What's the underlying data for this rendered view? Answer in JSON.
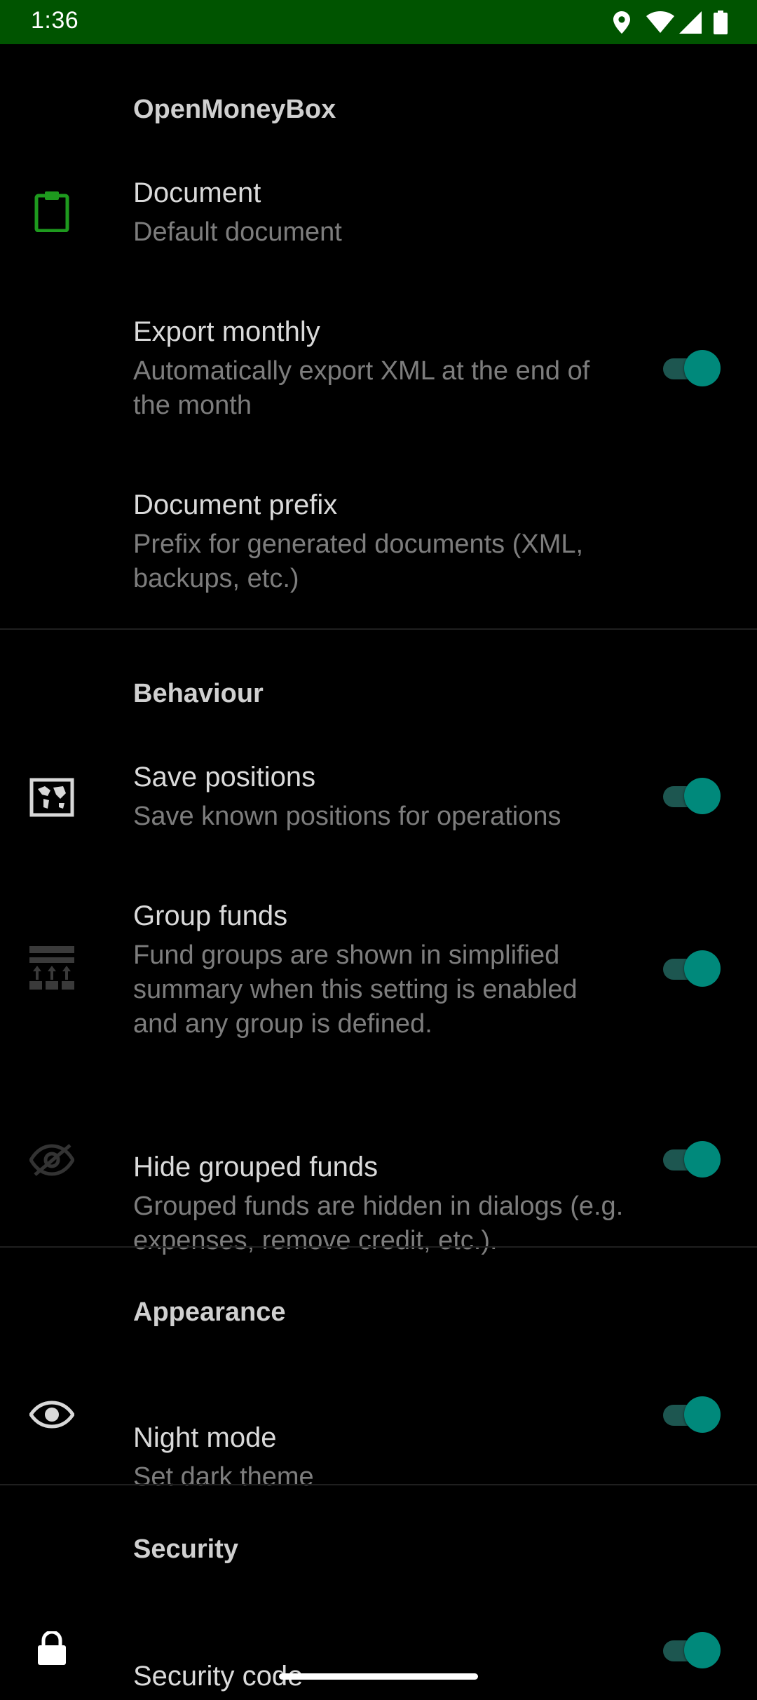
{
  "status_bar": {
    "time": "1:36",
    "icons": [
      "location-icon",
      "wifi-icon",
      "signal-icon",
      "battery-icon"
    ],
    "background": "#005400"
  },
  "colors": {
    "accent": "#00897b",
    "switch_track": "#1d5650",
    "document_icon": "#1e9a1e"
  },
  "sections": {
    "general": {
      "header": "OpenMoneyBox",
      "document": {
        "title": "Document",
        "summary": "Default document",
        "icon": "clipboard-icon"
      },
      "export_monthly": {
        "title": "Export monthly",
        "summary": "Automatically export XML at the end of the month",
        "checked": true
      },
      "document_prefix": {
        "title": "Document prefix",
        "summary": "Prefix for generated documents (XML, backups, etc.)"
      }
    },
    "behaviour": {
      "header": "Behaviour",
      "save_positions": {
        "title": "Save positions",
        "summary": "Save known positions for operations",
        "icon": "map-icon",
        "checked": true
      },
      "group_funds": {
        "title": "Group funds",
        "summary": "Fund groups are shown in simplified summary when this setting is enabled and any group is defined.",
        "icon": "group-funds-icon",
        "checked": true
      },
      "hide_grouped_funds": {
        "title": "Hide grouped funds",
        "summary": "Grouped funds are hidden in dialogs (e.g. expenses, remove credit, etc.).",
        "icon": "eye-off-icon",
        "checked": true
      }
    },
    "appearance": {
      "header": "Appearance",
      "night_mode": {
        "title": "Night mode",
        "summary": "Set dark theme",
        "icon": "eye-icon",
        "checked": true
      }
    },
    "security": {
      "header": "Security",
      "security_code": {
        "title": "Security code",
        "icon": "lock-icon",
        "checked": true
      }
    }
  }
}
